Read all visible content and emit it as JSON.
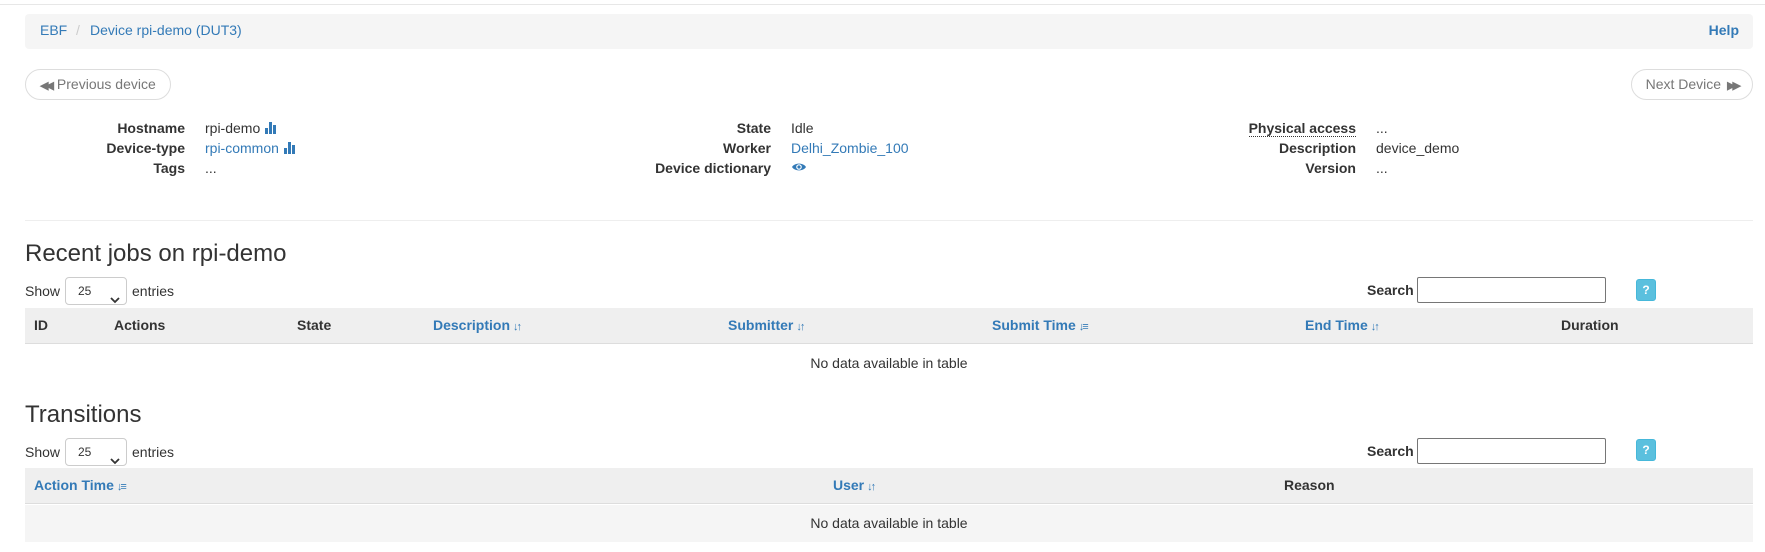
{
  "breadcrumb": {
    "root": "EBF",
    "separator": "/",
    "current": "Device rpi-demo (DUT3)",
    "help": "Help"
  },
  "pager": {
    "previous": "Previous device",
    "next": "Next Device"
  },
  "details": {
    "hostname_label": "Hostname",
    "hostname": "rpi-demo",
    "device_type_label": "Device-type",
    "device_type": "rpi-common",
    "tags_label": "Tags",
    "tags": "...",
    "state_label": "State",
    "state": "Idle",
    "worker_label": "Worker",
    "worker": "Delhi_Zombie_100",
    "dictionary_label": "Device dictionary",
    "physical_label": "Physical access",
    "physical": "...",
    "description_label": "Description",
    "description": "device_demo",
    "version_label": "Version",
    "version": "..."
  },
  "recent_jobs": {
    "title": "Recent jobs on rpi-demo",
    "show": "Show",
    "entries_value": "25",
    "entries": "entries",
    "search": "Search",
    "help_btn": "?",
    "columns": [
      "ID",
      "Actions",
      "State",
      "Description",
      "Submitter",
      "Submit Time",
      "End Time",
      "Duration"
    ],
    "empty": "No data available in table"
  },
  "transitions": {
    "title": "Transitions",
    "show": "Show",
    "entries_value": "25",
    "entries": "entries",
    "search": "Search",
    "help_btn": "?",
    "columns": [
      "Action Time",
      "User",
      "Reason"
    ],
    "empty": "No data available in table"
  },
  "colors": {
    "link": "#337ab7",
    "info": "#5bc0de",
    "header_bg": "#efefef"
  }
}
